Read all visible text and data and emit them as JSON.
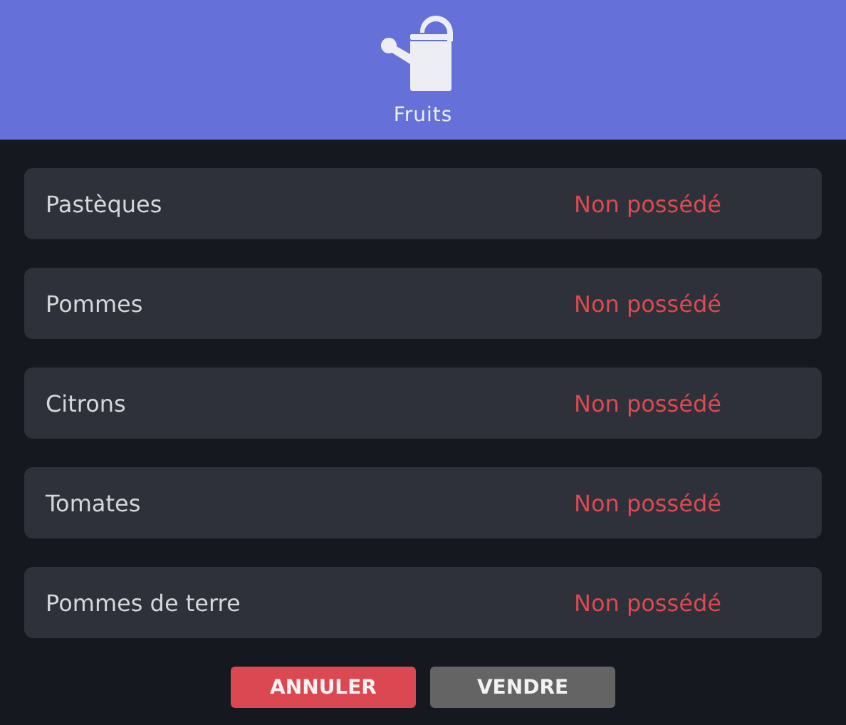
{
  "header": {
    "title": "Fruits"
  },
  "items": [
    {
      "name": "Pastèques",
      "status": "Non possédé",
      "owned": false
    },
    {
      "name": "Pommes",
      "status": "Non possédé",
      "owned": false
    },
    {
      "name": "Citrons",
      "status": "Non possédé",
      "owned": false
    },
    {
      "name": "Tomates",
      "status": "Non possédé",
      "owned": false
    },
    {
      "name": "Pommes de terre",
      "status": "Non possédé",
      "owned": false
    }
  ],
  "buttons": [
    {
      "label": "ANNULER",
      "kind": "cancel"
    },
    {
      "label": "VENDRE",
      "kind": "confirm"
    }
  ]
}
